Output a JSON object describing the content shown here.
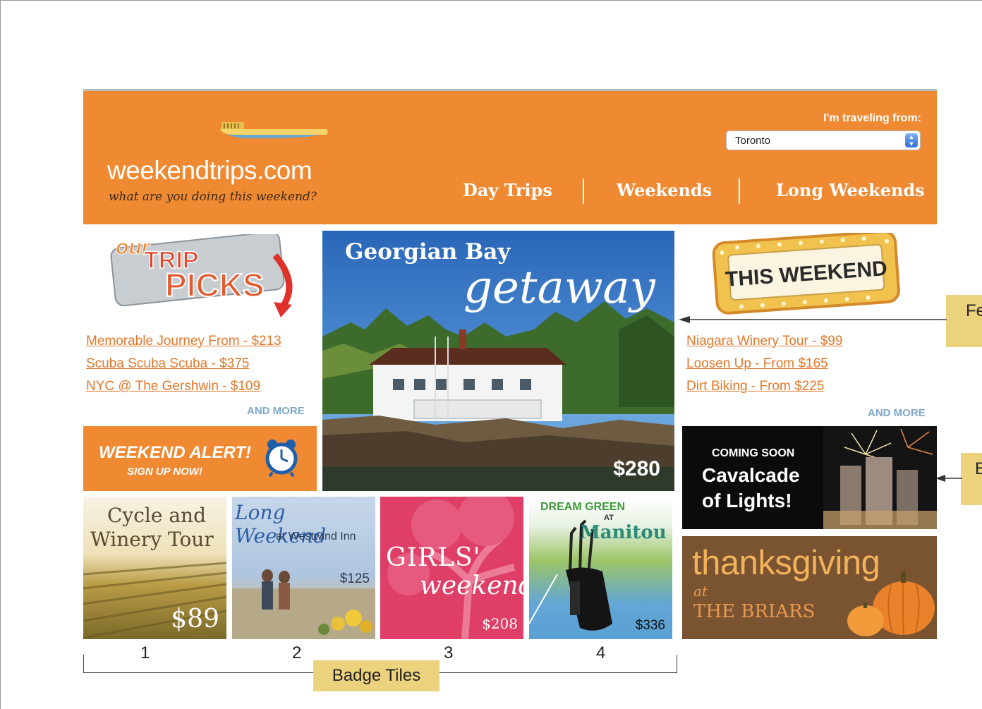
{
  "header": {
    "logo": "weekendtrips.com",
    "tagline": "what are you doing this weekend?",
    "from_label": "I'm traveling from:",
    "from_value": "Toronto",
    "nav": [
      "Day Trips",
      "Weekends",
      "Long Weekends"
    ]
  },
  "left": {
    "badge_line1": "our",
    "badge_line2": "TRIP",
    "badge_line3": "PICKS",
    "links": [
      "Memorable Journey From - $213",
      "Scuba Scuba Scuba - $375",
      "NYC @ The Gershwin - $109"
    ],
    "more": "AND MORE",
    "alert_title": "WEEKEND ALERT!",
    "alert_sub": "SIGN UP NOW!"
  },
  "feature": {
    "title": "Georgian Bay",
    "script": "getaway",
    "price": "$280"
  },
  "right": {
    "badge": "THIS WEEKEND",
    "links": [
      "Niagara Winery Tour - $99",
      "Loosen Up - From $165",
      "Dirt Biking - From $225"
    ],
    "more": "AND MORE",
    "coming_kicker": "COMING SOON",
    "coming_title1": "Cavalcade",
    "coming_title2": "of Lights!",
    "thanks_title": "thanksgiving",
    "thanks_at": "at",
    "thanks_place": "THE BRIARS"
  },
  "tiles": [
    {
      "line1": "Cycle and",
      "line2": "Winery Tour",
      "price": "$89"
    },
    {
      "line1": "Long Weekend",
      "line2": "at Westwind Inn",
      "price": "$125"
    },
    {
      "line1": "GIRLS'",
      "line2": "weekend",
      "price": "$208"
    },
    {
      "line1a": "DREAM",
      "line1b": "GREEN",
      "at": "AT",
      "line2": "Manitou",
      "price": "$336"
    }
  ],
  "annotations": {
    "numbers": [
      "1",
      "2",
      "3",
      "4"
    ],
    "badge_tiles": "Badge Tiles",
    "feature_label": "Fe",
    "badge_label": "B"
  },
  "colors": {
    "header_orange": "#ef8a32",
    "link_orange": "#e5782a",
    "more_blue": "#7fa8c9",
    "annotation_yellow": "#edd27e"
  }
}
